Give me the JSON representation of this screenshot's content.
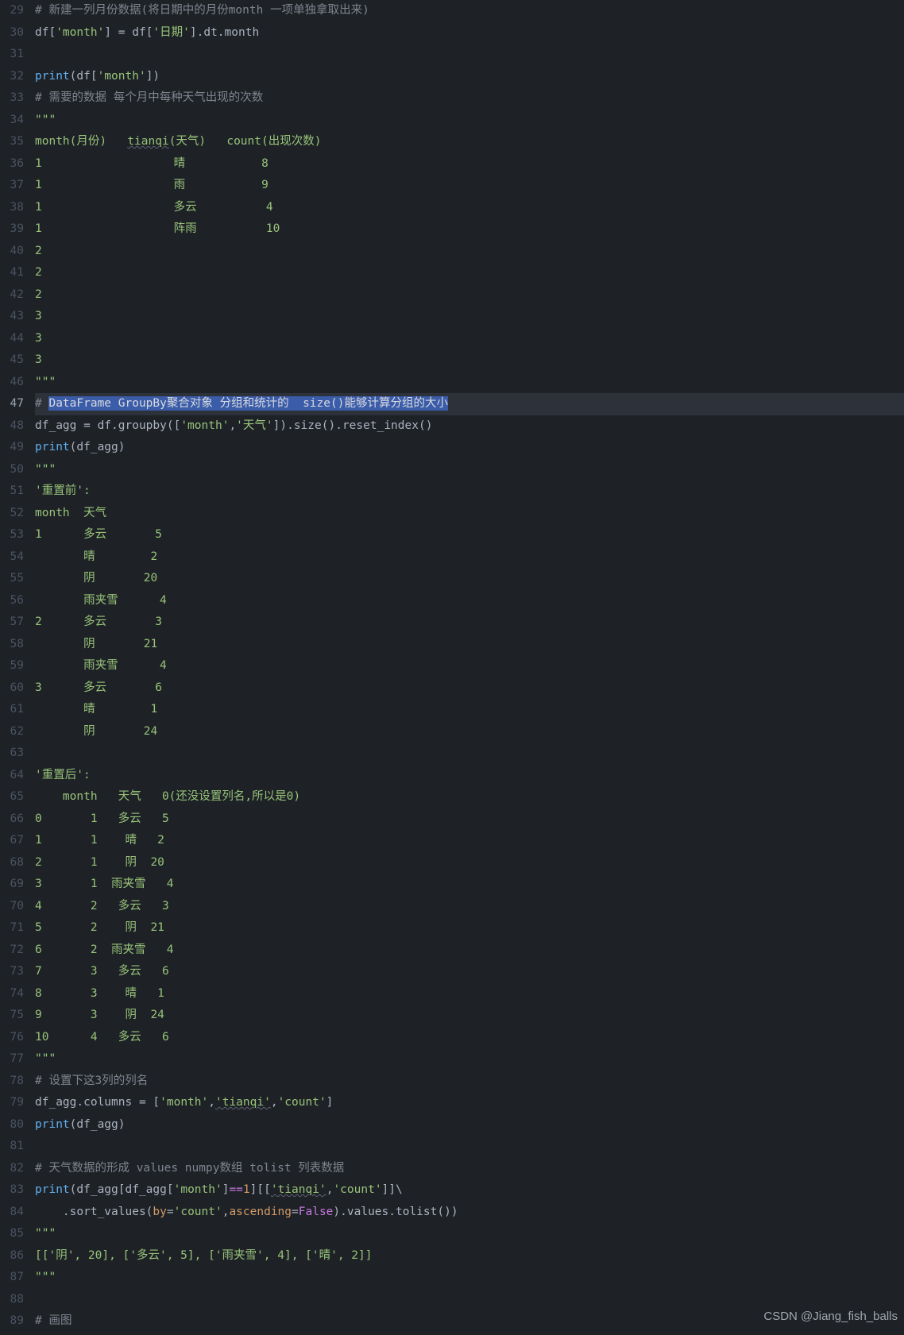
{
  "watermark": "CSDN @Jiang_fish_balls",
  "active_line": 47,
  "gutter": {
    "start": 29,
    "end": 89
  },
  "lines": {
    "29": [
      [
        "comment",
        "# 新建一列月份数据(将日期中的月份month 一项单独拿取出来)"
      ]
    ],
    "30": [
      [
        "id",
        "df["
      ],
      [
        "str",
        "'month'"
      ],
      [
        "id",
        "] = df["
      ],
      [
        "str",
        "'日期'"
      ],
      [
        "id",
        "].dt.month"
      ]
    ],
    "31": [
      [
        "id",
        ""
      ]
    ],
    "32": [
      [
        "func",
        "print"
      ],
      [
        "id",
        "(df["
      ],
      [
        "str",
        "'month'"
      ],
      [
        "id",
        "])"
      ]
    ],
    "33": [
      [
        "comment",
        "# 需要的数据 每个月中每种天气出现的次数"
      ]
    ],
    "34": [
      [
        "str",
        "\"\"\""
      ]
    ],
    "35": [
      [
        "str",
        "month(月份)   "
      ],
      [
        "str_w",
        "tianqi"
      ],
      [
        "str",
        "(天气)   count(出现次数)"
      ]
    ],
    "36": [
      [
        "str",
        "1                   晴           8"
      ]
    ],
    "37": [
      [
        "str",
        "1                   雨           9"
      ]
    ],
    "38": [
      [
        "str",
        "1                   多云          4"
      ]
    ],
    "39": [
      [
        "str",
        "1                   阵雨          10"
      ]
    ],
    "40": [
      [
        "str",
        "2"
      ]
    ],
    "41": [
      [
        "str",
        "2"
      ]
    ],
    "42": [
      [
        "str",
        "2"
      ]
    ],
    "43": [
      [
        "str",
        "3"
      ]
    ],
    "44": [
      [
        "str",
        "3"
      ]
    ],
    "45": [
      [
        "str",
        "3"
      ]
    ],
    "46": [
      [
        "str",
        "\"\"\""
      ]
    ],
    "47": [
      [
        "comment",
        "# "
      ],
      [
        "sel",
        "DataFrame GroupBy聚合对象 分组和统计的  size()能够计算分组的大小"
      ]
    ],
    "48": [
      [
        "id",
        "df_agg = df.groupby(["
      ],
      [
        "str",
        "'month'"
      ],
      [
        "id",
        ","
      ],
      [
        "str",
        "'天气'"
      ],
      [
        "id",
        "]).size().reset_index()"
      ]
    ],
    "49": [
      [
        "func",
        "print"
      ],
      [
        "id",
        "(df_agg)"
      ]
    ],
    "50": [
      [
        "str",
        "\"\"\""
      ]
    ],
    "51": [
      [
        "str",
        "'重置前':"
      ]
    ],
    "52": [
      [
        "str",
        "month  天气 "
      ]
    ],
    "53": [
      [
        "str",
        "1      多云       5"
      ]
    ],
    "54": [
      [
        "str",
        "       晴        2"
      ]
    ],
    "55": [
      [
        "str",
        "       阴       20"
      ]
    ],
    "56": [
      [
        "str",
        "       雨夹雪      4"
      ]
    ],
    "57": [
      [
        "str",
        "2      多云       3"
      ]
    ],
    "58": [
      [
        "str",
        "       阴       21"
      ]
    ],
    "59": [
      [
        "str",
        "       雨夹雪      4"
      ]
    ],
    "60": [
      [
        "str",
        "3      多云       6"
      ]
    ],
    "61": [
      [
        "str",
        "       晴        1"
      ]
    ],
    "62": [
      [
        "str",
        "       阴       24"
      ]
    ],
    "63": [
      [
        "str",
        ""
      ]
    ],
    "64": [
      [
        "str",
        "'重置后':"
      ]
    ],
    "65": [
      [
        "str",
        "    month   天气   0(还没设置列名,所以是0)"
      ]
    ],
    "66": [
      [
        "str",
        "0       1   多云   5"
      ]
    ],
    "67": [
      [
        "str",
        "1       1    晴   2"
      ]
    ],
    "68": [
      [
        "str",
        "2       1    阴  20"
      ]
    ],
    "69": [
      [
        "str",
        "3       1  雨夹雪   4"
      ]
    ],
    "70": [
      [
        "str",
        "4       2   多云   3"
      ]
    ],
    "71": [
      [
        "str",
        "5       2    阴  21"
      ]
    ],
    "72": [
      [
        "str",
        "6       2  雨夹雪   4"
      ]
    ],
    "73": [
      [
        "str",
        "7       3   多云   6"
      ]
    ],
    "74": [
      [
        "str",
        "8       3    晴   1"
      ]
    ],
    "75": [
      [
        "str",
        "9       3    阴  24"
      ]
    ],
    "76": [
      [
        "str",
        "10      4   多云   6"
      ]
    ],
    "77": [
      [
        "str",
        "\"\"\""
      ]
    ],
    "78": [
      [
        "comment",
        "# 设置下这3列的列名"
      ]
    ],
    "79": [
      [
        "id",
        "df_agg.columns = ["
      ],
      [
        "str",
        "'month'"
      ],
      [
        "id",
        ","
      ],
      [
        "str_w",
        "'tianqi'"
      ],
      [
        "id",
        ","
      ],
      [
        "str",
        "'count'"
      ],
      [
        "id",
        "]"
      ]
    ],
    "80": [
      [
        "func",
        "print"
      ],
      [
        "id",
        "(df_agg)"
      ]
    ],
    "81": [
      [
        "id",
        ""
      ]
    ],
    "82": [
      [
        "comment",
        "# 天气数据的形成 values numpy数组 tolist 列表数据"
      ]
    ],
    "83": [
      [
        "func",
        "print"
      ],
      [
        "id",
        "(df_agg[df_agg["
      ],
      [
        "str",
        "'month'"
      ],
      [
        "id",
        "]"
      ],
      [
        "kw",
        "=="
      ],
      [
        "num",
        "1"
      ],
      [
        "id",
        "][["
      ],
      [
        "str_w",
        "'tianqi'"
      ],
      [
        "id",
        ","
      ],
      [
        "str",
        "'count'"
      ],
      [
        "id",
        "]]\\"
      ]
    ],
    "84": [
      [
        "id",
        "    .sort_values("
      ],
      [
        "named",
        "by"
      ],
      [
        "id",
        "="
      ],
      [
        "str",
        "'count'"
      ],
      [
        "id",
        ","
      ],
      [
        "named",
        "ascending"
      ],
      [
        "id",
        "="
      ],
      [
        "kw",
        "False"
      ],
      [
        "id",
        ").values.tolist())"
      ]
    ],
    "85": [
      [
        "str",
        "\"\"\""
      ]
    ],
    "86": [
      [
        "str",
        "[['阴', 20], ['多云', 5], ['雨夹雪', 4], ['晴', 2]]"
      ]
    ],
    "87": [
      [
        "str",
        "\"\"\""
      ]
    ],
    "88": [
      [
        "id",
        ""
      ]
    ],
    "89": [
      [
        "comment",
        "# 画图"
      ]
    ]
  }
}
